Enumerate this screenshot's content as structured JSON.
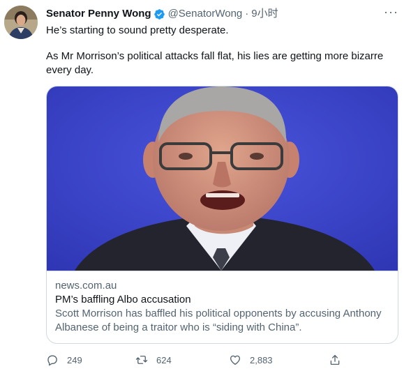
{
  "author": {
    "name": "Senator Penny Wong",
    "handle": "@SenatorWong",
    "separator": "·",
    "time": "9小时"
  },
  "more_label": "···",
  "tweet": {
    "line1": "He’s starting to sound pretty desperate.",
    "line2": "As Mr Morrison’s political attacks fall flat, his lies are getting more bizarre every day."
  },
  "card": {
    "domain": "news.com.au",
    "title": "PM’s baffling Albo accusation",
    "description": "Scott Morrison has baffled his political opponents by accusing Anthony Albanese of being a traitor who is “siding with China”."
  },
  "actions": {
    "replies": "249",
    "retweets": "624",
    "likes": "2,883"
  },
  "colors": {
    "verified": "#1d9bf0",
    "secondary_text": "#536471",
    "card_border": "#cfd9de",
    "image_background": "#3a43c8"
  },
  "icons": [
    "verified-badge-icon",
    "more-options-icon",
    "reply-icon",
    "retweet-icon",
    "like-icon",
    "share-icon"
  ]
}
